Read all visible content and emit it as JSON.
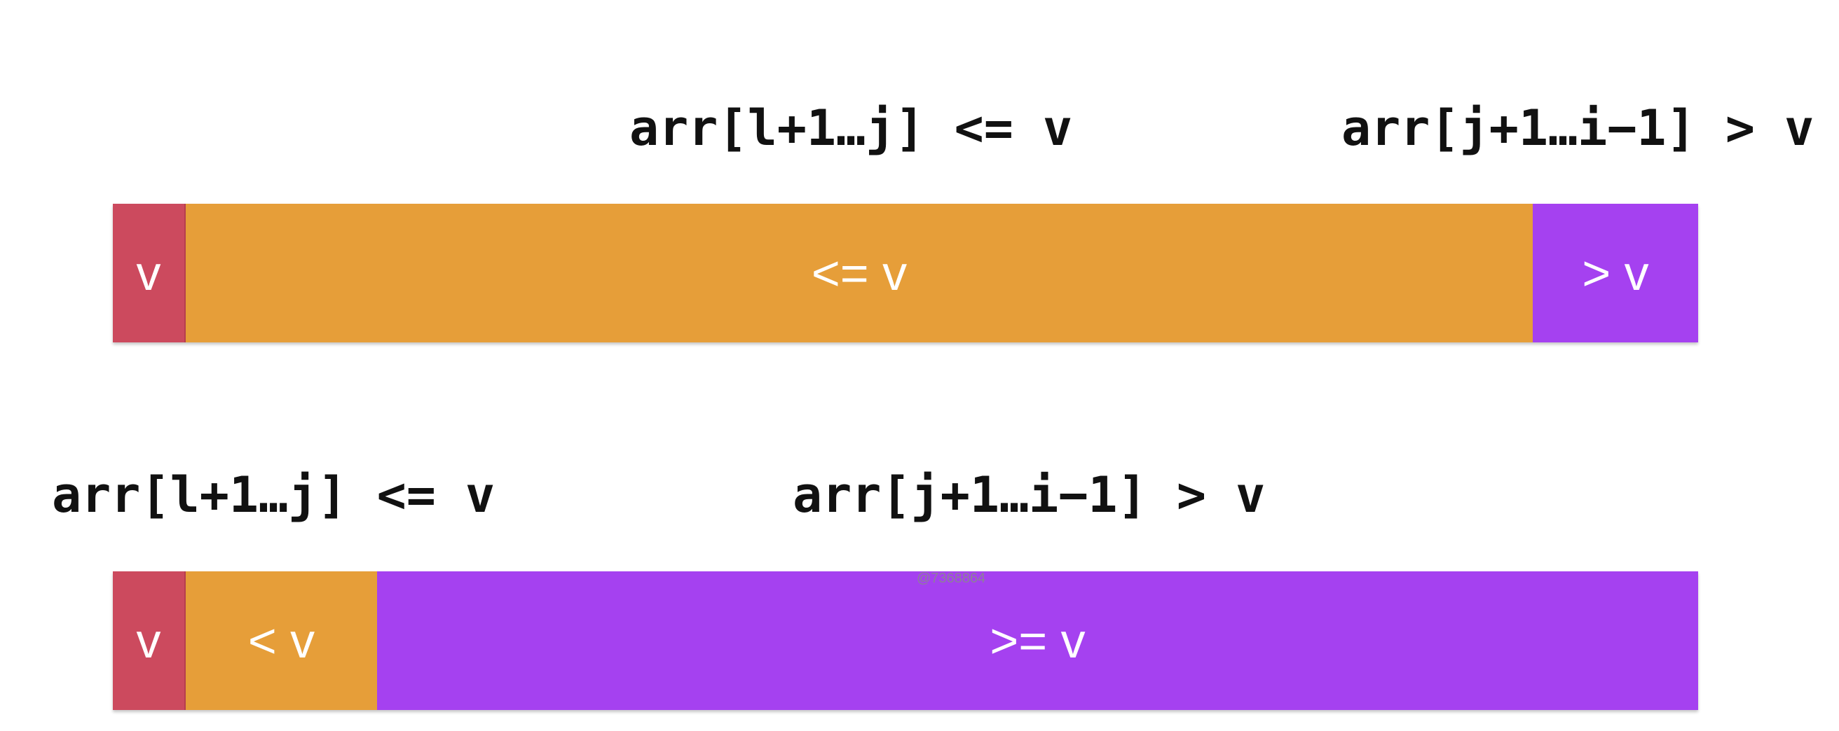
{
  "colors": {
    "pivot": "#CC4A5E",
    "less_equal": "#E69E39",
    "greater": "#A541F0",
    "label_text": "#111111",
    "segment_text": "#FFFFFF"
  },
  "top_diagram": {
    "label_left": "arr[l+1…j] <= v",
    "label_right": "arr[j+1…i−1] > v",
    "segments": {
      "pivot": "v",
      "left": "<= v",
      "right": "> v"
    }
  },
  "bottom_diagram": {
    "label_left": "arr[l+1…j] <= v",
    "label_right": "arr[j+1…i−1] > v",
    "segments": {
      "pivot": "v",
      "left": "< v",
      "right": ">= v"
    }
  },
  "watermark": "@7368864"
}
